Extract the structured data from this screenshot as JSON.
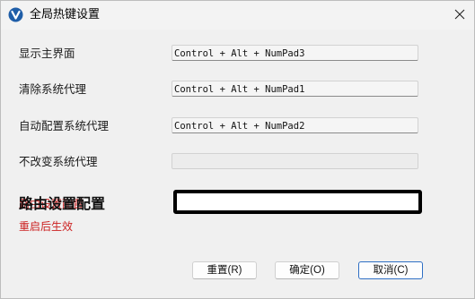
{
  "window": {
    "title": "全局热键设置",
    "icon": "app-logo-icon",
    "close_icon": "close-icon"
  },
  "rows": [
    {
      "label": "显示主界面",
      "value": "Control + Alt + NumPad3"
    },
    {
      "label": "清除系统代理",
      "value": "Control + Alt + NumPad1"
    },
    {
      "label": "自动配置系统代理",
      "value": "Control + Alt + NumPad2"
    },
    {
      "label": "不改变系统代理",
      "value": ""
    }
  ],
  "routing": {
    "label_overlay": "路由设置配置",
    "label_under": "路由设置配置",
    "value": ""
  },
  "note": "重启后生效",
  "buttons": {
    "reset": "重置(R)",
    "ok": "确定(O)",
    "cancel": "取消(C)"
  },
  "colors": {
    "accent": "#2f6fc4",
    "warning_text": "#cc2222"
  }
}
